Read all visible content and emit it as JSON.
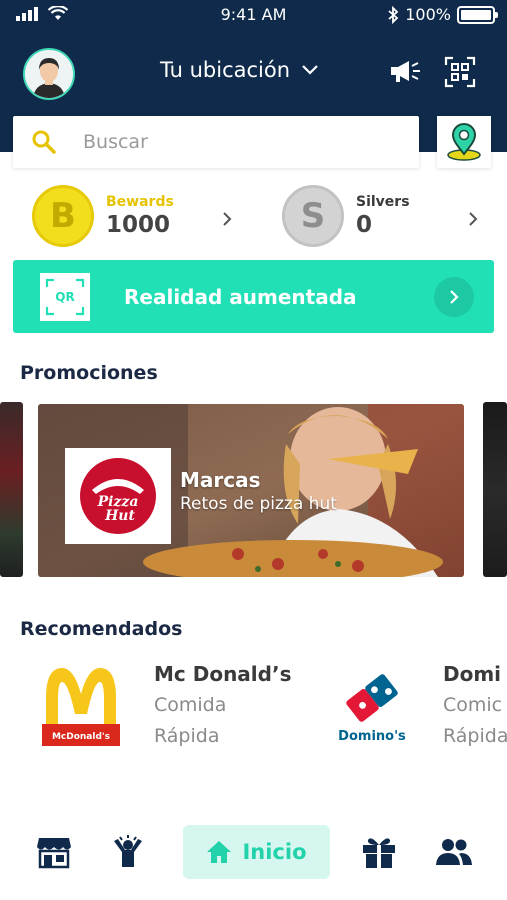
{
  "status_bar": {
    "time": "9:41 AM",
    "battery": "100%"
  },
  "header": {
    "location_label": "Tu ubicación"
  },
  "search": {
    "placeholder": "Buscar"
  },
  "points": {
    "bewards": {
      "label": "Bewards",
      "value": "1000",
      "coin_letter": "B",
      "color": "#e6c300"
    },
    "silvers": {
      "label": "Silvers",
      "value": "0",
      "coin_letter": "S",
      "color": "#3a3a3a"
    }
  },
  "ar_banner": {
    "icon_text": "QR",
    "title": "Realidad aumentada"
  },
  "promotions": {
    "title": "Promociones",
    "items": [
      {
        "logo_text_1": "Pizza",
        "logo_text_2": "Hut",
        "title": "Marcas",
        "subtitle": "Retos de pizza hut"
      }
    ]
  },
  "recommended": {
    "title": "Recomendados",
    "items": [
      {
        "name": "Mc Donald’s",
        "category_1": "Comida",
        "category_2": "Rápida",
        "logo_text": "McDonald's"
      },
      {
        "name": "Domi",
        "category_1": "Comic",
        "category_2": "Rápida",
        "logo_text": "Domino's"
      }
    ]
  },
  "bottom_nav": {
    "home_label": "Inicio"
  },
  "colors": {
    "header": "#0f2a4a",
    "accent": "#22e0b6",
    "bewards": "#f3de1d"
  }
}
